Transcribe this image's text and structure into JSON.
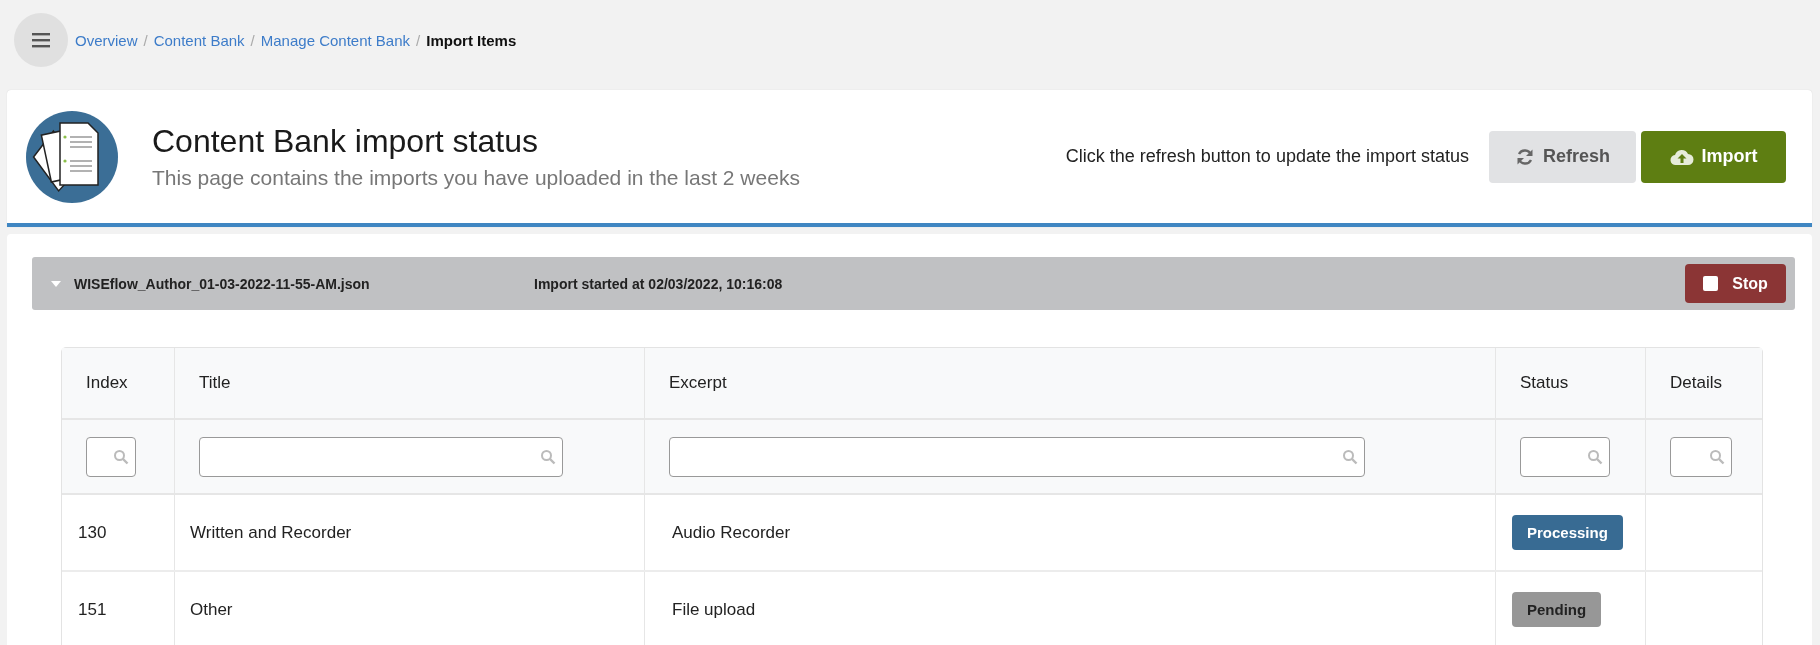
{
  "breadcrumb": [
    {
      "label": "Overview",
      "current": false
    },
    {
      "separator": "/",
      "label": "Content Bank",
      "current": false
    },
    {
      "separator": "/",
      "label": "Manage Content Bank",
      "current": false
    },
    {
      "separator": "/",
      "label": "Import Items",
      "current": true
    }
  ],
  "header": {
    "title": "Content Bank import status",
    "subtitle": "This page contains the imports you have uploaded in the last 2 weeks",
    "hint": "Click the refresh button to update the import status",
    "buttons": [
      {
        "label": "Refresh",
        "kind": "refresh"
      },
      {
        "label": "Import",
        "kind": "import"
      }
    ]
  },
  "import": {
    "file": "WISEflow_Author_01-03-2022-11-55-AM.json",
    "started": "Import started at 02/03/2022, 10:16:08",
    "expanded": true,
    "stop_button": "Stop"
  },
  "table": {
    "columns": [
      "Index",
      "Title",
      "Excerpt",
      "Status",
      "Details"
    ],
    "rows": [
      {
        "index": "130",
        "title": "Written and Recorder",
        "excerpt": "Audio Recorder",
        "status": "Processing",
        "kind": "processing"
      },
      {
        "index": "151",
        "title": "Other",
        "excerpt": "File upload",
        "status": "Pending",
        "kind": "pending"
      }
    ]
  }
}
